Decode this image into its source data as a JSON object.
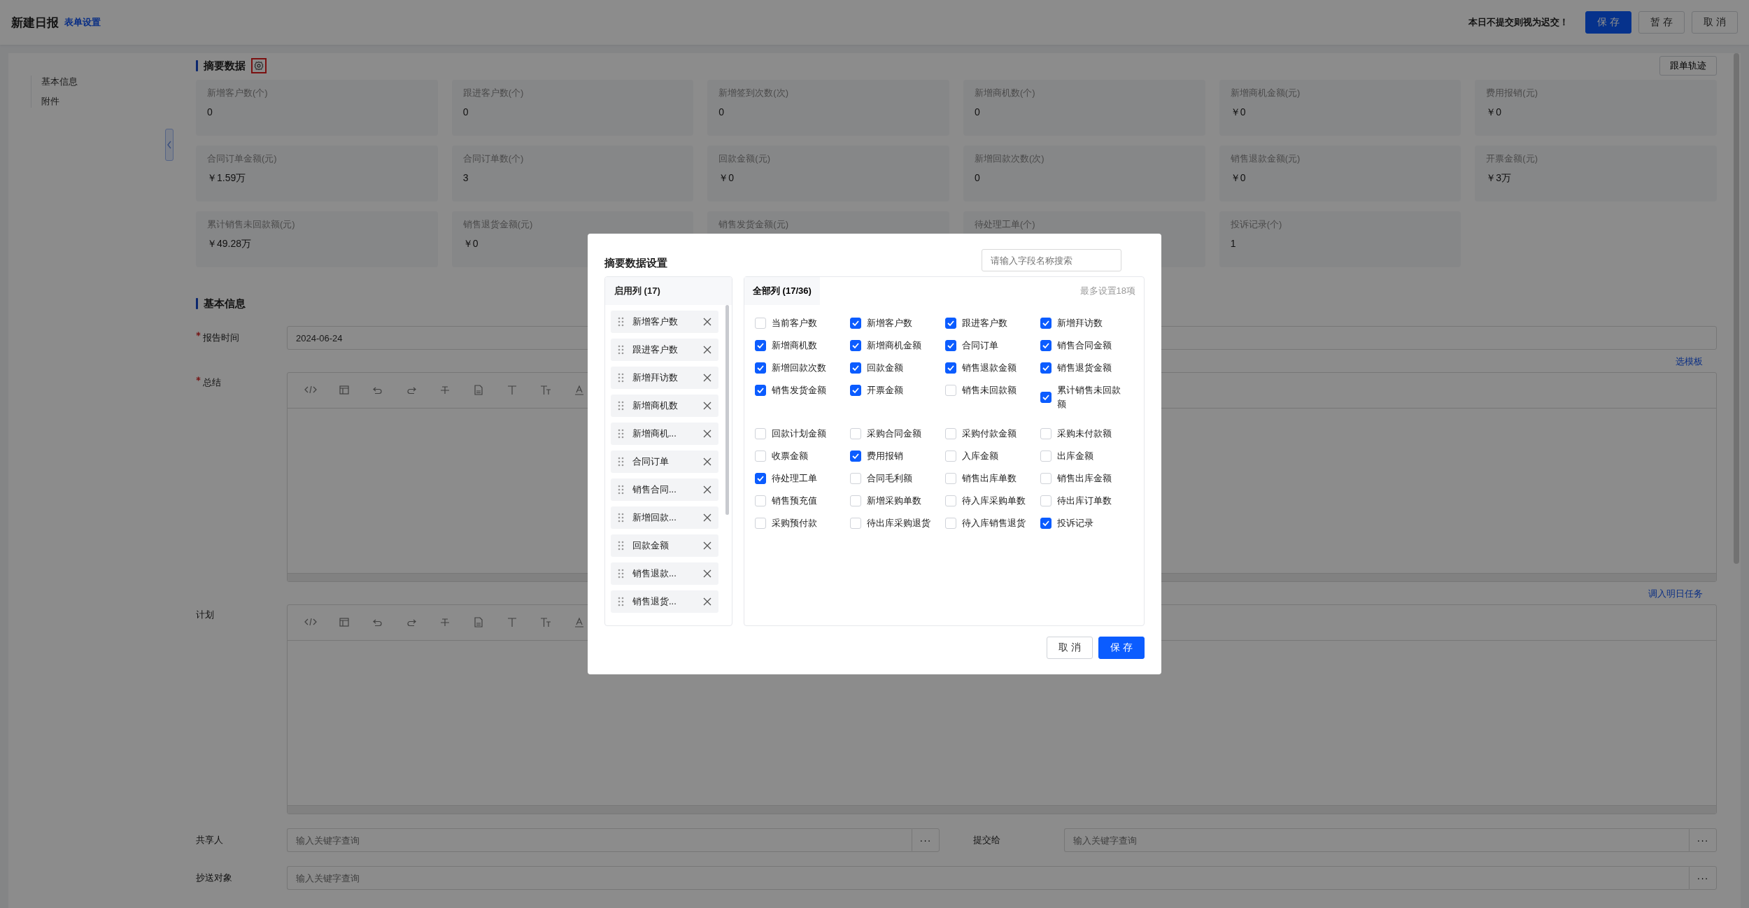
{
  "header": {
    "title": "新建日报",
    "settings_link": "表单设置",
    "notice": "本日不提交则视为迟交！",
    "buttons": [
      {
        "label": "保 存",
        "kind": "primary"
      },
      {
        "label": "暂 存",
        "kind": "default"
      },
      {
        "label": "取 消",
        "kind": "default"
      }
    ]
  },
  "sidebar": {
    "items": [
      {
        "label": "基本信息"
      },
      {
        "label": "附件"
      }
    ]
  },
  "summary": {
    "title": "摘要数据",
    "track_button": "跟单轨迹",
    "cards": [
      {
        "label": "新增客户数(个)",
        "value": "0"
      },
      {
        "label": "跟进客户数(个)",
        "value": "0"
      },
      {
        "label": "新增签到次数(次)",
        "value": "0"
      },
      {
        "label": "新增商机数(个)",
        "value": "0"
      },
      {
        "label": "新增商机金额(元)",
        "value": "￥0"
      },
      {
        "label": "费用报销(元)",
        "value": "￥0"
      },
      {
        "label": "合同订单金额(元)",
        "value": "￥1.59万"
      },
      {
        "label": "合同订单数(个)",
        "value": "3"
      },
      {
        "label": "回款金额(元)",
        "value": "￥0"
      },
      {
        "label": "新增回款次数(次)",
        "value": "0"
      },
      {
        "label": "销售退款金额(元)",
        "value": "￥0"
      },
      {
        "label": "开票金额(元)",
        "value": "￥3万"
      },
      {
        "label": "累计销售未回款额(元)",
        "value": "￥49.28万"
      },
      {
        "label": "销售退货金额(元)",
        "value": "￥0"
      },
      {
        "label": "销售发货金额(元)"
      },
      {
        "label": "待处理工单(个)"
      },
      {
        "label": "投诉记录(个)",
        "value": "1"
      }
    ]
  },
  "basic_info": {
    "title": "基本信息",
    "rows": [
      {
        "kind": "date",
        "label": "报告时间",
        "required": true,
        "value": "2024-06-24"
      },
      {
        "kind": "editor",
        "label": "总结",
        "required": true,
        "link": "选模板"
      },
      {
        "kind": "editor",
        "label": "计划",
        "required": false,
        "link": "调入明日任务"
      },
      {
        "kind": "pickers",
        "fields": [
          {
            "label": "共享人",
            "placeholder": "输入关键字查询",
            "more": "···"
          },
          {
            "label": "提交给",
            "placeholder": "输入关键字查询",
            "more": "···"
          }
        ]
      },
      {
        "kind": "pickers",
        "fields": [
          {
            "label": "抄送对象",
            "placeholder": "输入关键字查询",
            "more": "···"
          }
        ]
      }
    ]
  },
  "dialog": {
    "title": "摘要数据设置",
    "search_placeholder": "请输入字段名称搜索",
    "enabled_columns": {
      "title": "启用列 (17)",
      "items": [
        "新增客户数",
        "跟进客户数",
        "新增拜访数",
        "新增商机数",
        "新增商机...",
        "合同订单",
        "销售合同...",
        "新增回款...",
        "回款金额",
        "销售退款...",
        "销售退货..."
      ]
    },
    "all_columns": {
      "title": "全部列 (17/36)",
      "hint": "最多设置18项",
      "groups": [
        {
          "items": [
            {
              "label": "当前客户数",
              "checked": false
            },
            {
              "label": "新增客户数",
              "checked": true
            },
            {
              "label": "跟进客户数",
              "checked": true
            },
            {
              "label": "新增拜访数",
              "checked": true
            },
            {
              "label": "新增商机数",
              "checked": true
            },
            {
              "label": "新增商机金额",
              "checked": true
            },
            {
              "label": "合同订单",
              "checked": true
            },
            {
              "label": "销售合同金额",
              "checked": true
            },
            {
              "label": "新增回款次数",
              "checked": true
            },
            {
              "label": "回款金额",
              "checked": true
            },
            {
              "label": "销售退款金额",
              "checked": true
            },
            {
              "label": "销售退货金额",
              "checked": true
            },
            {
              "label": "销售发货金额",
              "checked": true
            },
            {
              "label": "开票金额",
              "checked": true
            },
            {
              "label": "销售未回款额",
              "checked": false
            },
            {
              "label": "累计销售未回款额",
              "checked": true
            }
          ]
        },
        {
          "items": [
            {
              "label": "回款计划金额",
              "checked": false
            },
            {
              "label": "采购合同金额",
              "checked": false
            },
            {
              "label": "采购付款金额",
              "checked": false
            },
            {
              "label": "采购未付款额",
              "checked": false
            },
            {
              "label": "收票金额",
              "checked": false
            },
            {
              "label": "费用报销",
              "checked": true
            },
            {
              "label": "入库金额",
              "checked": false
            },
            {
              "label": "出库金额",
              "checked": false
            },
            {
              "label": "待处理工单",
              "checked": true
            },
            {
              "label": "合同毛利额",
              "checked": false
            },
            {
              "label": "销售出库单数",
              "checked": false
            },
            {
              "label": "销售出库金额",
              "checked": false
            },
            {
              "label": "销售预充值",
              "checked": false
            },
            {
              "label": "新增采购单数",
              "checked": false
            },
            {
              "label": "待入库采购单数",
              "checked": false
            },
            {
              "label": "待出库订单数",
              "checked": false
            },
            {
              "label": "采购预付款",
              "checked": false
            },
            {
              "label": "待出库采购退货",
              "checked": false
            },
            {
              "label": "待入库销售退货",
              "checked": false
            },
            {
              "label": "投诉记录",
              "checked": true
            }
          ]
        }
      ]
    },
    "buttons": [
      {
        "label": "取 消",
        "kind": "default"
      },
      {
        "label": "保 存",
        "kind": "primary"
      }
    ]
  }
}
